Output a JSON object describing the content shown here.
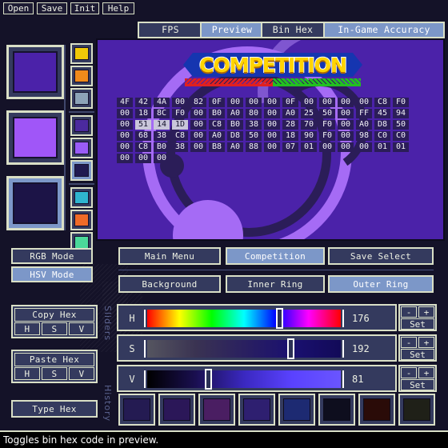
{
  "app": {
    "background_color": "#141228",
    "chrome_border": "#d9dfc6",
    "panel_fill": "#343a5e",
    "selected_fill": "#7c97c8"
  },
  "menubar": {
    "items": [
      {
        "label": "Open"
      },
      {
        "label": "Save"
      },
      {
        "label": "Init"
      },
      {
        "label": "Help"
      }
    ]
  },
  "toolbar": {
    "buttons": [
      {
        "label": "FPS",
        "selected": false
      },
      {
        "label": "Preview",
        "selected": true
      },
      {
        "label": "Bin Hex",
        "selected": false
      },
      {
        "label": "In-Game Accuracy",
        "selected": true
      }
    ]
  },
  "preview": {
    "logo_text": "COMPETITION",
    "background_color": "#4b22a9",
    "outer_ring_color": "#a56bf5",
    "inner_ring_color": "#2b1d58",
    "hex_rows": [
      [
        {
          "v": "4F",
          "hl": false
        },
        {
          "v": "42",
          "hl": false
        },
        {
          "v": "4A",
          "hl": false
        },
        {
          "v": "00",
          "hl": false
        },
        {
          "v": "82",
          "hl": false
        },
        {
          "v": "0F",
          "hl": false
        },
        {
          "v": "00",
          "hl": false
        },
        {
          "v": "00",
          "hl": false
        },
        {
          "v": "00",
          "hl": false
        },
        {
          "v": "0F",
          "hl": false
        },
        {
          "v": "00",
          "hl": false
        },
        {
          "v": "00",
          "hl": false
        },
        {
          "v": "00",
          "hl": false
        },
        {
          "v": "00",
          "hl": false
        },
        {
          "v": "C8",
          "hl": false
        },
        {
          "v": "F0",
          "hl": false
        }
      ],
      [
        {
          "v": "00",
          "hl": false
        },
        {
          "v": "18",
          "hl": false
        },
        {
          "v": "8C",
          "hl": false
        },
        {
          "v": "F0",
          "hl": false
        },
        {
          "v": "00",
          "hl": false
        },
        {
          "v": "B0",
          "hl": false
        },
        {
          "v": "A0",
          "hl": false
        },
        {
          "v": "80",
          "hl": false
        },
        {
          "v": "00",
          "hl": false
        },
        {
          "v": "A0",
          "hl": false
        },
        {
          "v": "25",
          "hl": false
        },
        {
          "v": "50",
          "hl": false
        },
        {
          "v": "00",
          "hl": false
        },
        {
          "v": "FF",
          "hl": false
        },
        {
          "v": "45",
          "hl": false
        },
        {
          "v": "94",
          "hl": false
        }
      ],
      [
        {
          "v": "00",
          "hl": false
        },
        {
          "v": "51",
          "hl": true
        },
        {
          "v": "14",
          "hl": true
        },
        {
          "v": "1D",
          "hl": true
        },
        {
          "v": "00",
          "hl": false
        },
        {
          "v": "C8",
          "hl": false
        },
        {
          "v": "B0",
          "hl": false
        },
        {
          "v": "38",
          "hl": false
        },
        {
          "v": "00",
          "hl": false
        },
        {
          "v": "28",
          "hl": false
        },
        {
          "v": "70",
          "hl": false
        },
        {
          "v": "F0",
          "hl": false
        },
        {
          "v": "00",
          "hl": false
        },
        {
          "v": "A0",
          "hl": false
        },
        {
          "v": "D8",
          "hl": false
        },
        {
          "v": "50",
          "hl": false
        }
      ],
      [
        {
          "v": "00",
          "hl": false
        },
        {
          "v": "68",
          "hl": false
        },
        {
          "v": "38",
          "hl": false
        },
        {
          "v": "C8",
          "hl": false
        },
        {
          "v": "00",
          "hl": false
        },
        {
          "v": "A0",
          "hl": false
        },
        {
          "v": "D8",
          "hl": false
        },
        {
          "v": "50",
          "hl": false
        },
        {
          "v": "00",
          "hl": false
        },
        {
          "v": "18",
          "hl": false
        },
        {
          "v": "90",
          "hl": false
        },
        {
          "v": "F0",
          "hl": false
        },
        {
          "v": "00",
          "hl": false
        },
        {
          "v": "98",
          "hl": false
        },
        {
          "v": "C0",
          "hl": false
        },
        {
          "v": "C0",
          "hl": false
        }
      ],
      [
        {
          "v": "00",
          "hl": false
        },
        {
          "v": "C8",
          "hl": false
        },
        {
          "v": "B0",
          "hl": false
        },
        {
          "v": "38",
          "hl": false
        },
        {
          "v": "00",
          "hl": false
        },
        {
          "v": "B8",
          "hl": false
        },
        {
          "v": "A0",
          "hl": false
        },
        {
          "v": "88",
          "hl": false
        },
        {
          "v": "00",
          "hl": false
        },
        {
          "v": "07",
          "hl": false
        },
        {
          "v": "01",
          "hl": false
        },
        {
          "v": "00",
          "hl": false
        },
        {
          "v": "00",
          "hl": false
        },
        {
          "v": "00",
          "hl": false
        },
        {
          "v": "01",
          "hl": false
        },
        {
          "v": "01",
          "hl": false
        }
      ],
      [
        {
          "v": "00",
          "hl": false
        },
        {
          "v": "00",
          "hl": false
        },
        {
          "v": "00",
          "hl": false
        }
      ]
    ]
  },
  "swatches": {
    "large": [
      {
        "name": "background-swatch",
        "color": "#4b22a9",
        "frame": "#343a5e",
        "selected": false
      },
      {
        "name": "inner-ring-swatch",
        "color": "#a056f8",
        "frame": "#343a5e",
        "selected": false
      },
      {
        "name": "outer-ring-swatch",
        "color": "#1c1447",
        "frame": "#7c97c8",
        "selected": true
      }
    ],
    "small_groups": [
      [
        {
          "name": "palette-swatch-yellow",
          "color": "#f0c808",
          "selected": false
        },
        {
          "name": "palette-swatch-orange",
          "color": "#ef8a1b",
          "selected": false
        },
        {
          "name": "palette-swatch-steel",
          "color": "#8da3b8",
          "selected": false
        }
      ],
      [
        {
          "name": "palette-swatch-indigo",
          "color": "#4b2a9e",
          "selected": false
        },
        {
          "name": "palette-swatch-violet",
          "color": "#9a5cf8",
          "selected": false
        },
        {
          "name": "palette-swatch-navy",
          "color": "#201a50",
          "selected": true
        }
      ],
      [
        {
          "name": "palette-swatch-cyan",
          "color": "#2fb5cf",
          "selected": false
        },
        {
          "name": "palette-swatch-vermilion",
          "color": "#ef6b28",
          "selected": false
        },
        {
          "name": "palette-swatch-mint",
          "color": "#4bd99a",
          "selected": false
        }
      ]
    ]
  },
  "modes": {
    "rgb_label": "RGB Mode",
    "rgb_selected": false,
    "hsv_label": "HSV Mode",
    "hsv_selected": true
  },
  "hex_tools": {
    "copy": {
      "label": "Copy Hex",
      "channels": [
        "H",
        "S",
        "V"
      ]
    },
    "paste": {
      "label": "Paste Hex",
      "channels": [
        "H",
        "S",
        "V"
      ]
    },
    "type": {
      "label": "Type Hex"
    }
  },
  "side_labels": {
    "sliders": "Sliders",
    "history": "History"
  },
  "screen_tabs": [
    {
      "label": "Main Menu",
      "selected": false
    },
    {
      "label": "Competition",
      "selected": true
    },
    {
      "label": "Save Select",
      "selected": false
    }
  ],
  "element_tabs": [
    {
      "label": "Background",
      "selected": false
    },
    {
      "label": "Inner Ring",
      "selected": false
    },
    {
      "label": "Outer Ring",
      "selected": true
    }
  ],
  "sliders": [
    {
      "channel": "H",
      "value": "176",
      "percent": 69,
      "gradient": "linear-gradient(to right,#ff0000,#ffff00,#00ff00,#00ffff,#0000ff,#ff00ff,#ff0000)",
      "minus": "-",
      "plus": "+",
      "set": "Set"
    },
    {
      "channel": "S",
      "value": "192",
      "percent": 75,
      "gradient": "linear-gradient(to right,#555560,#3a3352,#2a2060,#1a1070,#120a58)",
      "minus": "-",
      "plus": "+",
      "set": "Set"
    },
    {
      "channel": "V",
      "value": "81",
      "percent": 31,
      "gradient": "linear-gradient(to right,#000000,#1a0f50,#3a28c0,#5a42ff,#6a55ff)",
      "minus": "-",
      "plus": "+",
      "set": "Set"
    }
  ],
  "history": {
    "swatches": [
      {
        "name": "history-swatch-1",
        "color": "#241b52"
      },
      {
        "name": "history-swatch-2",
        "color": "#2b1758"
      },
      {
        "name": "history-swatch-3",
        "color": "#4a1e62"
      },
      {
        "name": "history-swatch-4",
        "color": "#2e1f70"
      },
      {
        "name": "history-swatch-5",
        "color": "#1d2a72"
      },
      {
        "name": "history-swatch-6",
        "color": "#0e0e1e"
      },
      {
        "name": "history-swatch-7",
        "color": "#2a0b08"
      },
      {
        "name": "history-swatch-8",
        "color": "#1f2018"
      }
    ]
  },
  "statusbar": {
    "message": "Toggles bin hex code in preview."
  }
}
